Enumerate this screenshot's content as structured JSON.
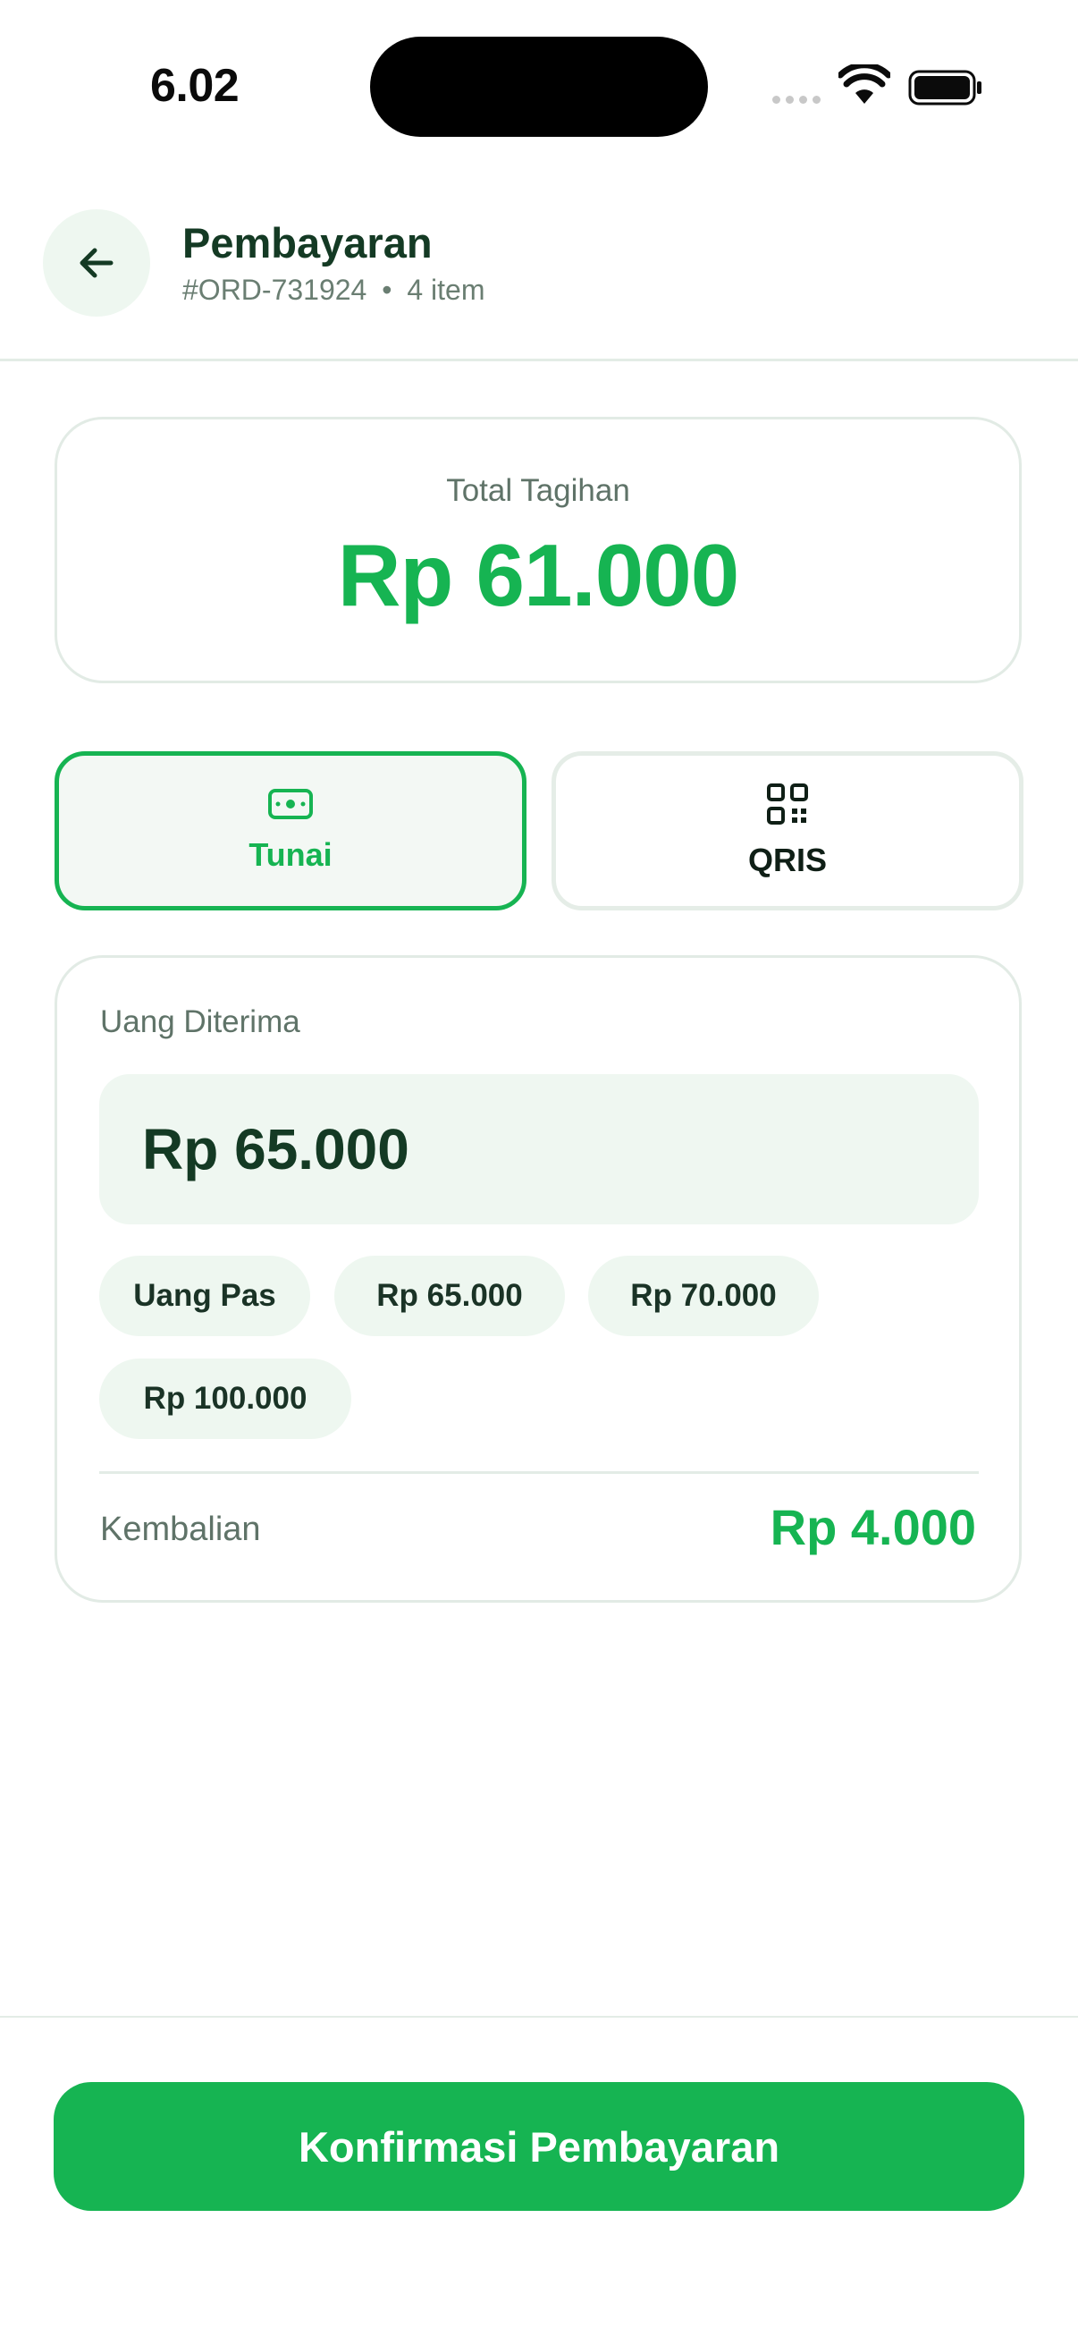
{
  "status_bar": {
    "time": "6.02"
  },
  "header": {
    "title": "Pembayaran",
    "order_id": "#ORD-731924",
    "item_count": "4 item",
    "separator": "•"
  },
  "total": {
    "label": "Total Tagihan",
    "amount": "Rp 61.000"
  },
  "payment_methods": [
    {
      "label": "Tunai",
      "icon": "cash-icon",
      "selected": true
    },
    {
      "label": "QRIS",
      "icon": "qr-code-icon",
      "selected": false
    }
  ],
  "cash": {
    "received_label": "Uang Diterima",
    "received_value": "Rp 65.000",
    "quick_amounts": [
      "Uang Pas",
      "Rp 65.000",
      "Rp 70.000",
      "Rp 100.000"
    ],
    "change_label": "Kembalian",
    "change_amount": "Rp 4.000"
  },
  "footer": {
    "confirm_label": "Konfirmasi Pembayaran"
  },
  "colors": {
    "accent": "#16b452",
    "text_dark": "#143a24",
    "text_muted": "#6a7e72",
    "chip_bg": "#eef7f0"
  }
}
